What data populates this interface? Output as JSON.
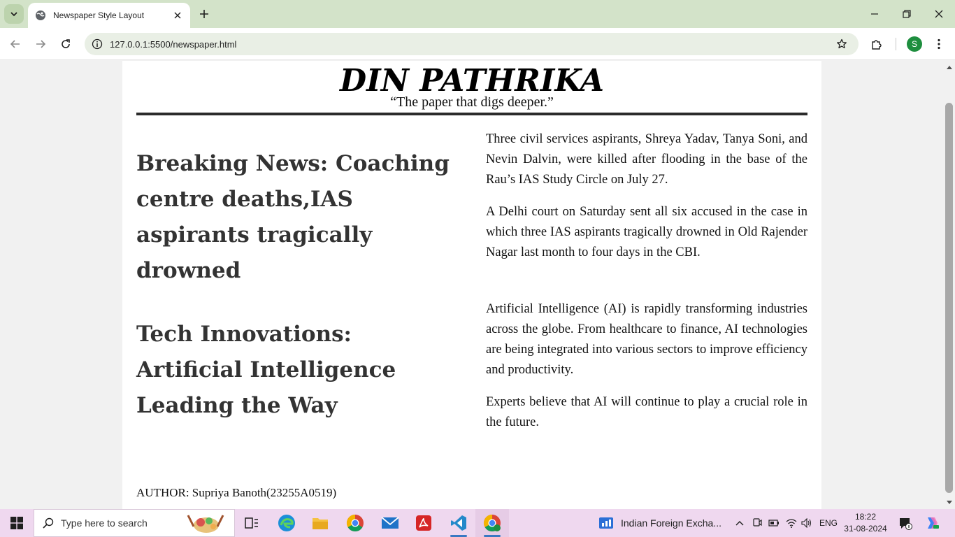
{
  "browser": {
    "tab_title": "Newspaper Style Layout",
    "url": "127.0.0.1:5500/newspaper.html",
    "profile_initial": "S"
  },
  "page": {
    "masthead": "DIN PATHRIKA",
    "tagline": "“The paper that digs deeper.”",
    "articles": [
      {
        "headline": "Breaking News: Coaching centre deaths,IAS aspirants tragically drowned",
        "paragraphs": [
          "Three civil services aspirants, Shreya Yadav, Tanya Soni, and Nevin Dalvin, were killed after flooding in the base of the Rau’s IAS Study Circle on July 27.",
          "A Delhi court on Saturday sent all six accused in the case in which three IAS aspirants tragically drowned in Old Rajender Nagar last month to four days in the CBI."
        ]
      },
      {
        "headline": "Tech Innovations: Artificial Intelligence Leading the Way",
        "paragraphs": [
          "Artificial Intelligence (AI) is rapidly transforming industries across the globe. From healthcare to finance, AI technologies are being integrated into various sectors to improve efficiency and productivity.",
          "Experts believe that AI will continue to play a crucial role in the future."
        ]
      }
    ],
    "author": "AUTHOR: Supriya Banoth(23255A0519)"
  },
  "taskbar": {
    "search_placeholder": "Type here to search",
    "news_widget": "Indian Foreign Excha...",
    "language": "ENG",
    "time": "18:22",
    "date": "31-08-2024"
  },
  "colors": {
    "tab_strip": "#d3e3c9",
    "omnibox": "#e9efe5",
    "profile": "#1e8e3e",
    "taskbar": "#efd8ef",
    "headline": "#333333"
  }
}
